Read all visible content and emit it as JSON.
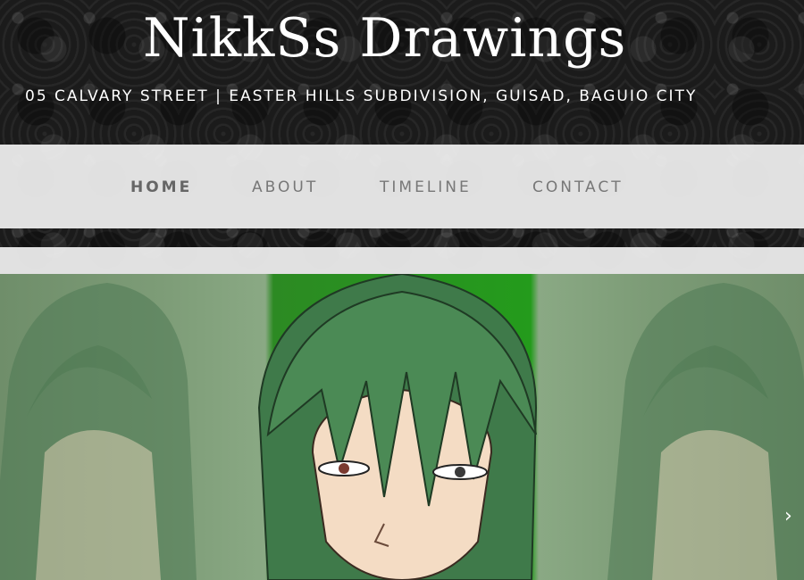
{
  "site": {
    "title": "NikkSs Drawings",
    "address": "05 CALVARY STREET | EASTER HILLS SUBDIVISION, GUISAD, BAGUIO CITY"
  },
  "nav": {
    "items": [
      {
        "label": "HOME",
        "active": true
      },
      {
        "label": "ABOUT",
        "active": false
      },
      {
        "label": "TIMELINE",
        "active": false
      },
      {
        "label": "CONTACT",
        "active": false
      }
    ]
  },
  "slider": {
    "next_label": "›"
  },
  "colors": {
    "nav_bg": "#f0f0f0",
    "nav_text": "#777777",
    "accent_green": "#249b1c",
    "hair_green": "#3f7a4a"
  }
}
